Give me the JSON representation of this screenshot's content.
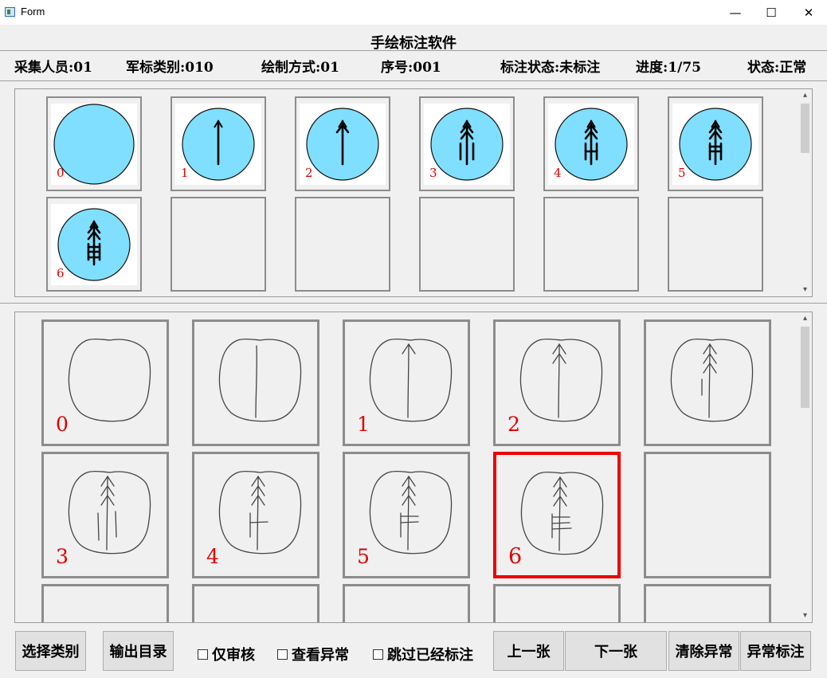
{
  "window": {
    "title": "Form",
    "minimize": "—",
    "maximize": "☐",
    "close": "✕"
  },
  "heading": "手绘标注软件",
  "info": {
    "collector": "采集人员:01",
    "category": "军标类别:010",
    "draw_mode": "绘制方式:01",
    "serial": "序号:001",
    "label_status": "标注状态:未标注",
    "progress": "进度:1/75",
    "state": "状态:正常"
  },
  "templates": [
    "0",
    "1",
    "2",
    "3",
    "4",
    "5",
    "6"
  ],
  "drawings": [
    "0",
    "",
    "1",
    "2",
    "",
    "3",
    "4",
    "5",
    "6"
  ],
  "selected_drawing": "6",
  "buttons": {
    "select_category": "选择类别",
    "output_dir": "输出目录",
    "prev": "上一张",
    "next": "下一张",
    "clear_abnormal": "清除异常",
    "mark_abnormal": "异常标注"
  },
  "checkboxes": {
    "review_only": "仅审核",
    "view_abnormal": "查看异常",
    "skip_labeled": "跳过已经标注"
  },
  "colors": {
    "circle_fill": "#80dfff",
    "number": "#e00000",
    "selected_border": "#ee0000"
  },
  "icons": {
    "scroll_up": "▴",
    "scroll_down": "▾"
  }
}
